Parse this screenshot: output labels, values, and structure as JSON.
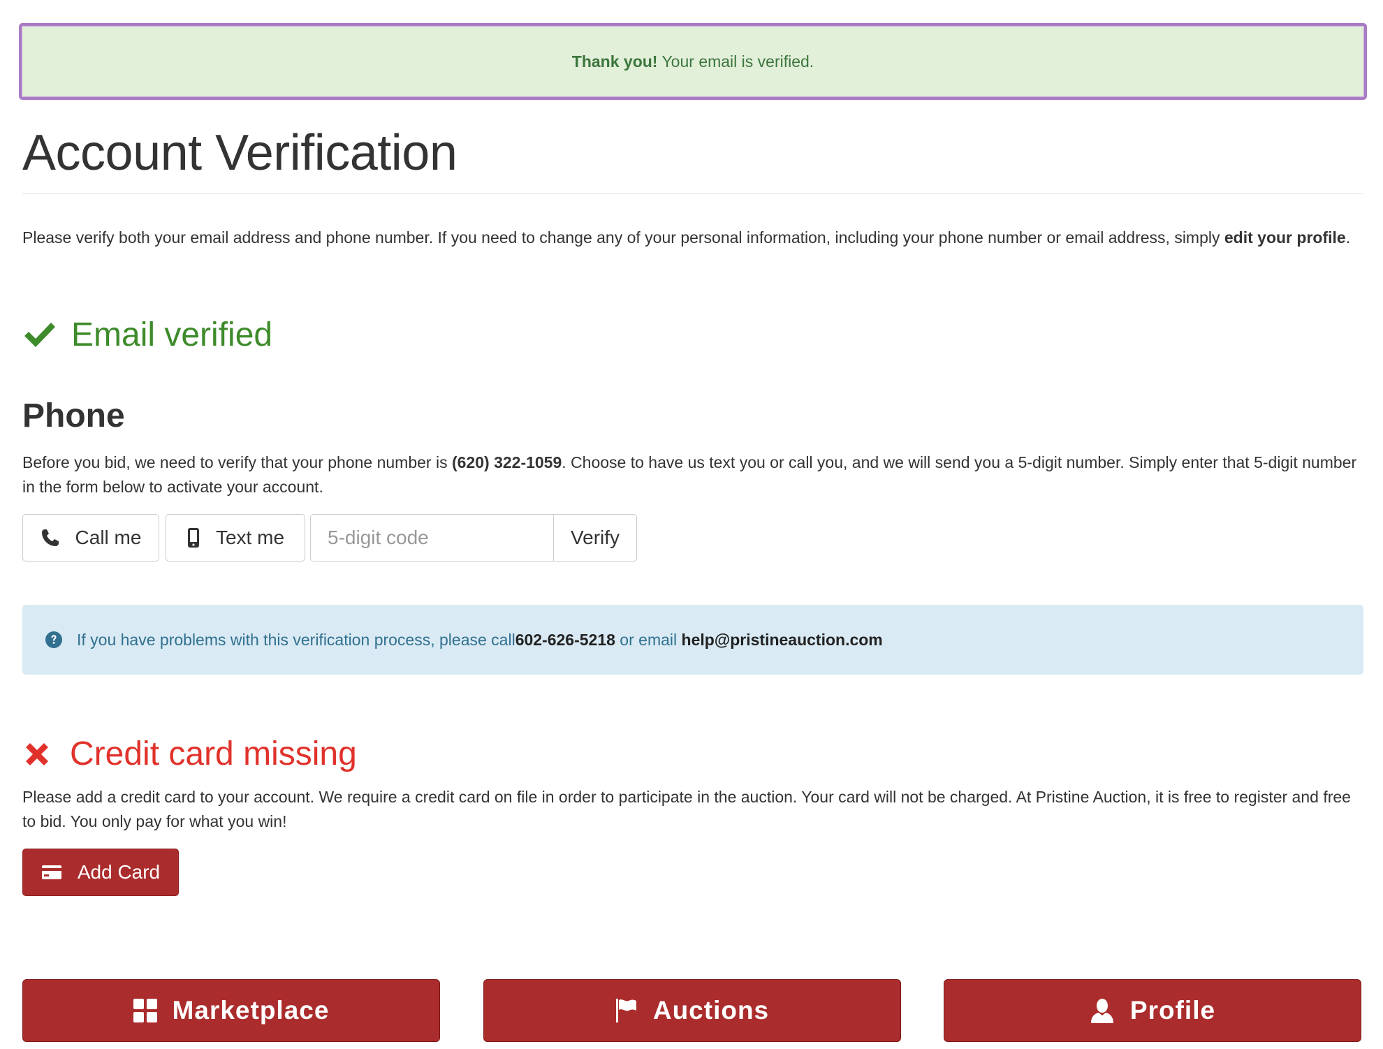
{
  "alert": {
    "strong": "Thank you!",
    "message": "Your email is verified."
  },
  "page_title": "Account Verification",
  "intro": {
    "text": "Please verify both your email address and phone number. If you need to change any of your personal information, including your phone number or email address, simply ",
    "link": "edit your profile",
    "end": "."
  },
  "email": {
    "status": "Email verified",
    "icon": "checkmark-icon",
    "color": "#3d8b2a"
  },
  "phone": {
    "heading": "Phone",
    "text_before": "Before you bid, we need to verify that your phone number is ",
    "number": "(620) 322-1059",
    "text_after": ". Choose to have us text you or call you, and we will send you a 5-digit number. Simply enter that 5-digit number in the form below to activate your account.",
    "call_label": "Call me",
    "text_label": "Text me",
    "code_placeholder": "5-digit code",
    "code_value": "",
    "verify_label": "Verify"
  },
  "help": {
    "text_before": "If you have problems with this verification process, please call ",
    "phone": "602-626-5218",
    "text_middle": " or email ",
    "email": "help@pristineauction.com",
    "icon": "question-circle-icon"
  },
  "card": {
    "status": "Credit card missing",
    "icon": "x-icon",
    "color": "#e0322b",
    "text": "Please add a credit card to your account. We require a credit card on file in order to participate in the auction. Your card will not be charged. At Pristine Auction, it is free to register and free to bid. You only pay for what you win!",
    "add_label": "Add Card"
  },
  "nav": {
    "marketplace": "Marketplace",
    "auctions": "Auctions",
    "profile": "Profile"
  },
  "colors": {
    "brand_red": "#ab2c2c",
    "success_bg": "#e2efd9",
    "info_bg": "#d9eaf4"
  }
}
